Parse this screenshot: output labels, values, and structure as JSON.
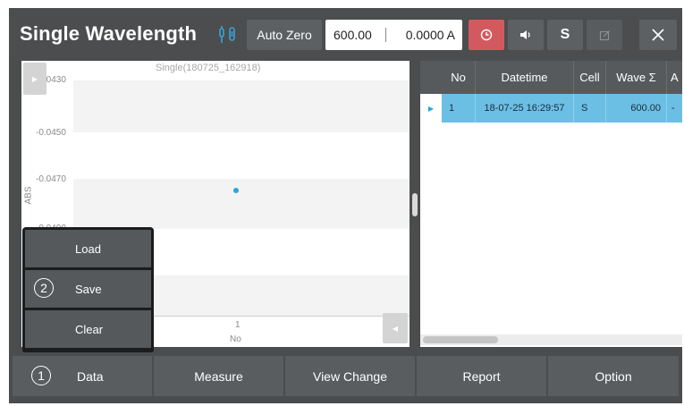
{
  "header": {
    "title": "Single Wavelength",
    "auto_zero_label": "Auto Zero",
    "wavelength_value": "600.00",
    "absorbance_value": "0.0000 A",
    "s_label": "S",
    "timer_icon": "timer-icon",
    "sound_icon": "speaker-icon",
    "edit_icon": "edit-icon",
    "close_icon": "close-icon",
    "link_icon": "link-icon"
  },
  "colors": {
    "accent_red": "#d25a5e",
    "selection_blue": "#6bbfe4",
    "point_blue": "#29a6d8"
  },
  "chart_data": {
    "type": "scatter",
    "title": "Single(180725_162918)",
    "ylabel": "ABS",
    "xlabel": "No",
    "y_ticks": [
      "-0.0430",
      "-0.0450",
      "-0.0470",
      "-0.0490"
    ],
    "x_ticks": [
      "1"
    ],
    "series": [
      {
        "x": [
          1
        ],
        "y": [
          -0.0475
        ]
      }
    ]
  },
  "table": {
    "columns": [
      "No",
      "Datetime",
      "Cell",
      "Wave Σ",
      "A"
    ],
    "rows": [
      {
        "no": "1",
        "datetime": "18-07-25 16:29:57",
        "cell": "S",
        "wave": "600.00",
        "abs": "-"
      }
    ]
  },
  "popup": {
    "number": "2",
    "items": [
      "Load",
      "Save",
      "Clear"
    ]
  },
  "nav": {
    "number": "1",
    "items": [
      "Data",
      "Measure",
      "View Change",
      "Report",
      "Option"
    ]
  }
}
